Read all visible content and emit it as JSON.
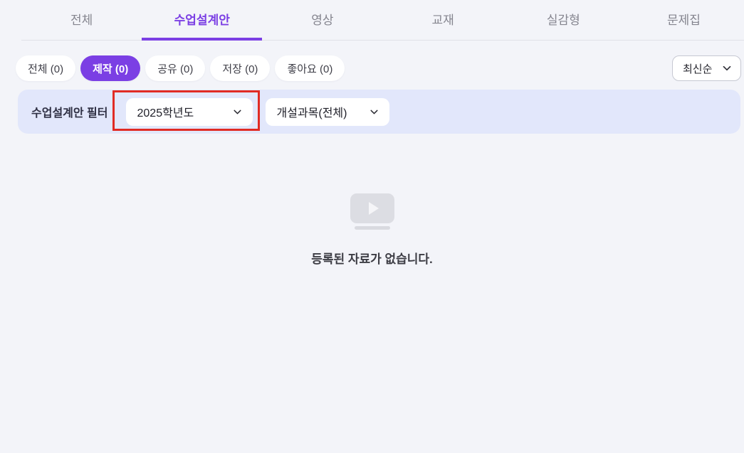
{
  "tabs": {
    "items": [
      {
        "label": "전체",
        "active": false
      },
      {
        "label": "수업설계안",
        "active": true
      },
      {
        "label": "영상",
        "active": false
      },
      {
        "label": "교재",
        "active": false
      },
      {
        "label": "실감형",
        "active": false
      },
      {
        "label": "문제집",
        "active": false
      }
    ]
  },
  "toolbar": {
    "pills": [
      {
        "label": "전체 (0)",
        "active": false
      },
      {
        "label": "제작 (0)",
        "active": true
      },
      {
        "label": "공유 (0)",
        "active": false
      },
      {
        "label": "저장 (0)",
        "active": false
      },
      {
        "label": "좋아요 (0)",
        "active": false
      }
    ],
    "sort": {
      "value": "최신순",
      "icon": "chevron-down-icon"
    }
  },
  "filter_bar": {
    "label": "수업설계안 필터",
    "dropdowns": [
      {
        "value": "2025학년도",
        "icon": "chevron-down-icon",
        "annotated": true
      },
      {
        "value": "개설과목(전체)",
        "icon": "chevron-down-icon",
        "annotated": false
      }
    ]
  },
  "empty_state": {
    "icon": "video-play-icon",
    "message": "등록된 자료가 없습니다."
  },
  "annotation": {
    "type": "highlight-box",
    "color": "#e12b24",
    "target": "year-dropdown"
  },
  "colors": {
    "accent_purple": "#7b3fe4",
    "page_background": "#f3f4f9",
    "filter_bar_background": "#e2e7fb",
    "annotation_red": "#e12b24"
  }
}
